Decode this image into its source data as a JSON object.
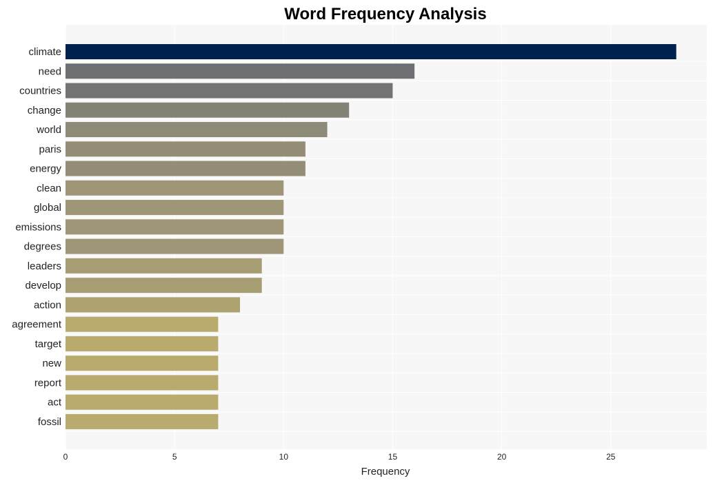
{
  "chart_data": {
    "type": "bar",
    "orientation": "horizontal",
    "title": "Word Frequency Analysis",
    "xlabel": "Frequency",
    "ylabel": "",
    "xlim": [
      0,
      29.4
    ],
    "xticks": [
      0,
      5,
      10,
      15,
      20,
      25
    ],
    "grid": true,
    "categories": [
      "climate",
      "need",
      "countries",
      "change",
      "world",
      "paris",
      "energy",
      "clean",
      "global",
      "emissions",
      "degrees",
      "leaders",
      "develop",
      "action",
      "agreement",
      "target",
      "new",
      "report",
      "act",
      "fossil"
    ],
    "values": [
      28,
      16,
      15,
      13,
      12,
      11,
      11,
      10,
      10,
      10,
      10,
      9,
      9,
      8,
      7,
      7,
      7,
      7,
      7,
      7
    ],
    "colors": [
      "#00214d",
      "#6e6f73",
      "#737373",
      "#858375",
      "#8e8a78",
      "#958e76",
      "#958e76",
      "#9e9676",
      "#9e9676",
      "#9e9676",
      "#9e9676",
      "#a69d72",
      "#a69d72",
      "#ada370",
      "#b8ab6d",
      "#b8ab6d",
      "#b8ab6d",
      "#b8ab6d",
      "#b8ab6d",
      "#b8ab6d"
    ],
    "plot_background": "#f7f7f7"
  }
}
